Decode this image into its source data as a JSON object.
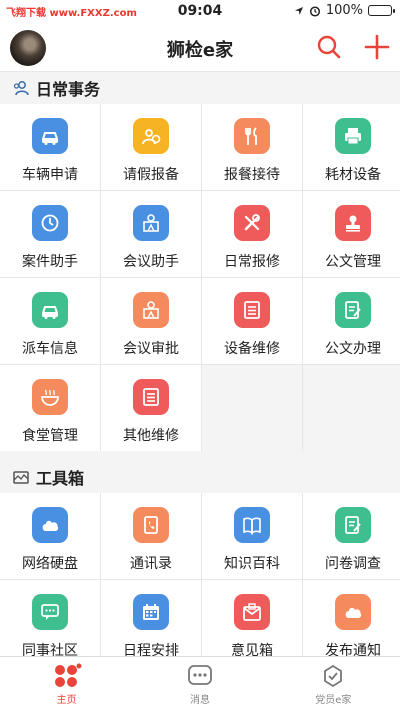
{
  "status_bar": {
    "watermark": "飞翔下载 www.FXXZ.com",
    "time": "09:04",
    "battery": "100%",
    "battery_level": 1.0
  },
  "nav": {
    "title": "狮检e家"
  },
  "sections": {
    "daily": {
      "title": "日常事务",
      "items": [
        {
          "label": "车辆申请",
          "color": "#4a90e2",
          "icon": "car-icon"
        },
        {
          "label": "请假报备",
          "color": "#f6b425",
          "icon": "leave-icon"
        },
        {
          "label": "报餐接待",
          "color": "#f58b5c",
          "icon": "fork-knife-icon"
        },
        {
          "label": "耗材设备",
          "color": "#3fbf8f",
          "icon": "printer-icon"
        },
        {
          "label": "案件助手",
          "color": "#4a90e2",
          "icon": "clock-badge-icon"
        },
        {
          "label": "会议助手",
          "color": "#4a90e2",
          "icon": "meeting-icon"
        },
        {
          "label": "日常报修",
          "color": "#ef5b5b",
          "icon": "wrench-icon"
        },
        {
          "label": "公文管理",
          "color": "#ef5b5b",
          "icon": "stamp-icon"
        },
        {
          "label": "派车信息",
          "color": "#3fbf8f",
          "icon": "car-icon"
        },
        {
          "label": "会议审批",
          "color": "#f58b5c",
          "icon": "meeting-icon"
        },
        {
          "label": "设备维修",
          "color": "#ef5b5b",
          "icon": "document-list-icon"
        },
        {
          "label": "公文办理",
          "color": "#3fbf8f",
          "icon": "edit-document-icon"
        },
        {
          "label": "食堂管理",
          "color": "#f58b5c",
          "icon": "bowl-icon"
        },
        {
          "label": "其他维修",
          "color": "#ef5b5b",
          "icon": "document-list-icon"
        }
      ]
    },
    "tools": {
      "title": "工具箱",
      "items": [
        {
          "label": "网络硬盘",
          "color": "#4a90e2",
          "icon": "cloud-icon"
        },
        {
          "label": "通讯录",
          "color": "#f58b5c",
          "icon": "contacts-icon"
        },
        {
          "label": "知识百科",
          "color": "#4a90e2",
          "icon": "book-icon"
        },
        {
          "label": "问卷调查",
          "color": "#3fbf8f",
          "icon": "edit-document-icon"
        },
        {
          "label": "同事社区",
          "color": "#3fbf8f",
          "icon": "chat-icon"
        },
        {
          "label": "日程安排",
          "color": "#4a90e2",
          "icon": "calendar-icon"
        },
        {
          "label": "意见箱",
          "color": "#ef5b5b",
          "icon": "mailbox-icon"
        },
        {
          "label": "发布通知",
          "color": "#f58b5c",
          "icon": "cloud-icon"
        }
      ]
    }
  },
  "tabbar": {
    "tabs": [
      {
        "label": "主页",
        "active": true
      },
      {
        "label": "消息",
        "active": false
      },
      {
        "label": "党员e家",
        "active": false
      }
    ]
  },
  "colors": {
    "accent": "#e8443a",
    "nav_icon": "#e8443a"
  }
}
